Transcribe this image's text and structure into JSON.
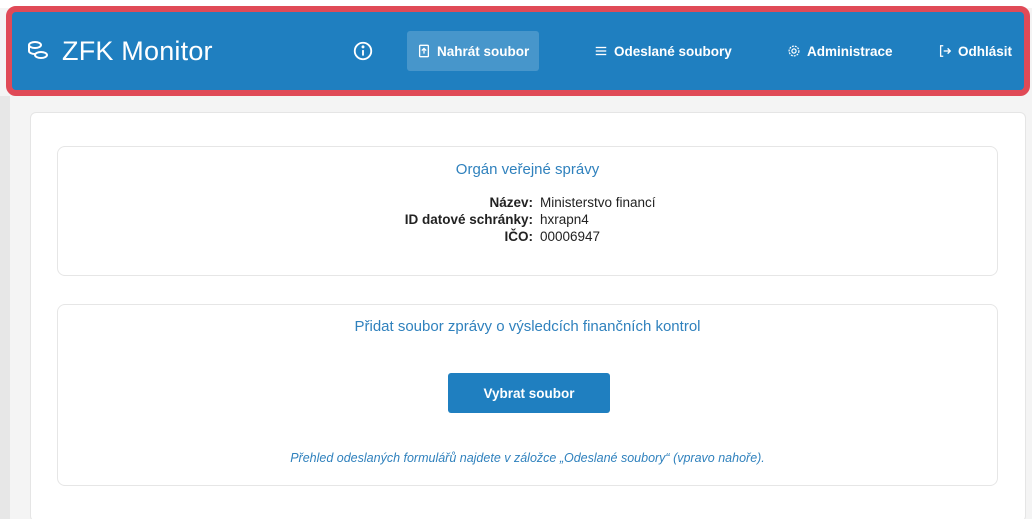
{
  "nav": {
    "brand": "ZFK Monitor",
    "items": [
      {
        "label": "Nahrát soubor",
        "icon": "upload-file-icon",
        "active": true
      },
      {
        "label": "Odeslané soubory",
        "icon": "list-icon",
        "active": false
      },
      {
        "label": "Administrace",
        "icon": "gear-icon",
        "active": false
      },
      {
        "label": "Odhlásit",
        "icon": "logout-icon",
        "active": false
      }
    ]
  },
  "org": {
    "title": "Orgán veřejné správy",
    "fields": [
      {
        "label": "Název:",
        "value": "Ministerstvo financí"
      },
      {
        "label": "ID datové schránky:",
        "value": "hxrapn4"
      },
      {
        "label": "IČO:",
        "value": "00006947"
      }
    ]
  },
  "upload": {
    "title": "Přidat soubor zprávy o výsledcích finančních kontrol",
    "button_label": "Vybrat soubor",
    "hint": "Přehled odeslaných formulářů najdete v záložce „Odeslané soubory“ (vpravo nahoře)."
  },
  "colors": {
    "navbar": "#1f7fc0",
    "highlight_border": "#e04a57",
    "accent_text": "#2f81bd"
  }
}
